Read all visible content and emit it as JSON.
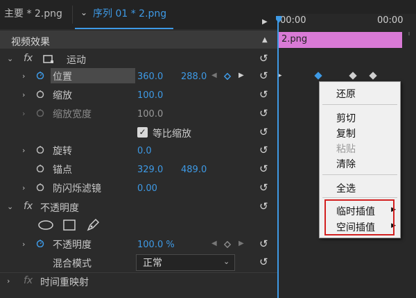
{
  "tabs": {
    "main_label": "主要 * 2.png",
    "sequence_label": "序列 01 * 2.png"
  },
  "panel": {
    "title": "视频效果"
  },
  "effects": {
    "motion": {
      "fx": "fx",
      "label": "运动"
    },
    "position": {
      "label": "位置",
      "x": "360.0",
      "y": "288.0"
    },
    "scale": {
      "label": "缩放",
      "value": "100.0"
    },
    "scale_width": {
      "label": "缩放宽度",
      "value": "100.0"
    },
    "uniform_scale": {
      "label": "等比缩放",
      "checked": true
    },
    "rotation": {
      "label": "旋转",
      "value": "0.0"
    },
    "anchor": {
      "label": "锚点",
      "x": "329.0",
      "y": "489.0"
    },
    "antiflicker": {
      "label": "防闪烁滤镜",
      "value": "0.00"
    },
    "opacity_group": {
      "fx": "fx",
      "label": "不透明度"
    },
    "opacity": {
      "label": "不透明度",
      "value": "100.0 %"
    },
    "blend_mode": {
      "label": "混合模式",
      "value": "正常"
    },
    "time_remap": {
      "fx": "fx",
      "label": "时间重映射"
    }
  },
  "timeline": {
    "timecode_left": "00:00",
    "timecode_right": "00:00",
    "clip_name": "2.png"
  },
  "context_menu": {
    "items": [
      "还原",
      "剪切",
      "复制",
      "粘贴",
      "清除",
      "全选",
      "临时插值",
      "空间插值"
    ]
  },
  "colors": {
    "accent": "#3e9ae6",
    "clip": "#d97ad6",
    "highlight": "#d21f1f"
  }
}
